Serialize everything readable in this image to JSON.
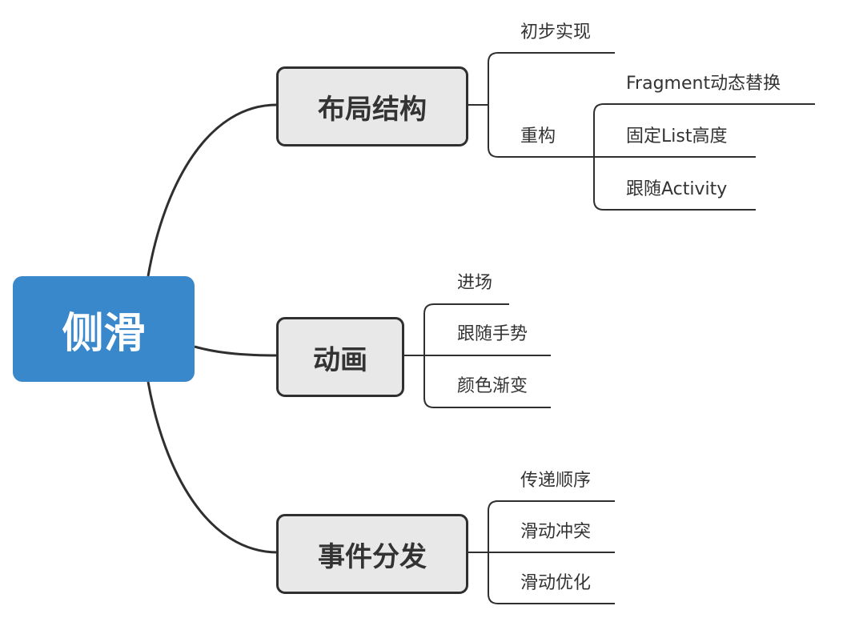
{
  "central": {
    "label": "侧滑",
    "color": "#3a88cc"
  },
  "branches": [
    {
      "label": "布局结构",
      "children": [
        {
          "label": "初步实现"
        },
        {
          "label": "重构",
          "children": [
            {
              "label": "Fragment动态替换"
            },
            {
              "label": "固定List高度"
            },
            {
              "label": "跟随Activity"
            }
          ]
        }
      ]
    },
    {
      "label": "动画",
      "children": [
        {
          "label": "进场"
        },
        {
          "label": "跟随手势"
        },
        {
          "label": "颜色渐变"
        }
      ]
    },
    {
      "label": "事件分发",
      "children": [
        {
          "label": "传递顺序"
        },
        {
          "label": "滑动冲突"
        },
        {
          "label": "滑动优化"
        }
      ]
    }
  ],
  "colors": {
    "line": "#2f2f2f",
    "topic_fill": "#e8e8e8",
    "text": "#333333"
  }
}
